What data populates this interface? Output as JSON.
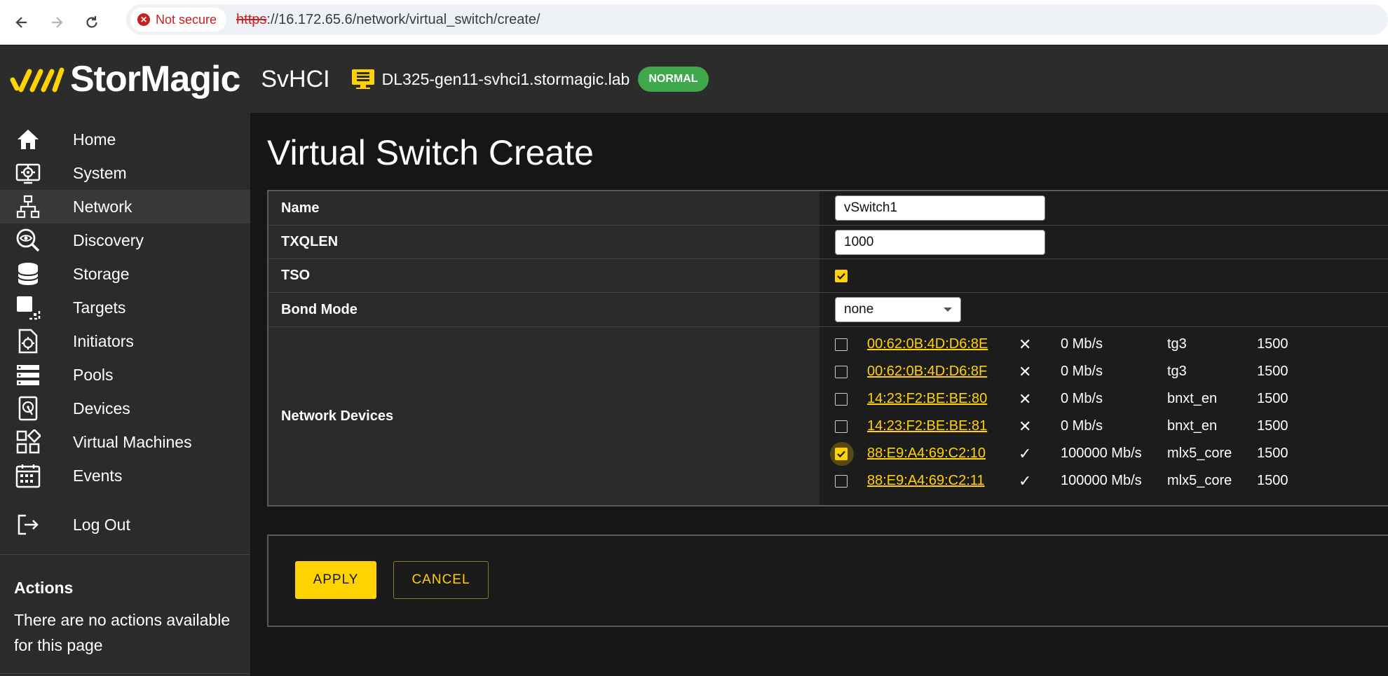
{
  "browser": {
    "security_label": "Not secure",
    "url_scheme": "https",
    "url_rest": "://16.172.65.6/network/virtual_switch/create/"
  },
  "header": {
    "brand": "StorMagic",
    "product": "SvHCI",
    "hostname": "DL325-gen11-svhci1.stormagic.lab",
    "status": "NORMAL",
    "logo_color": "#ffd200",
    "status_color": "#3fa84a"
  },
  "sidebar": {
    "items": [
      {
        "label": "Home",
        "icon": "home-icon"
      },
      {
        "label": "System",
        "icon": "system-icon"
      },
      {
        "label": "Network",
        "icon": "network-icon",
        "active": true
      },
      {
        "label": "Discovery",
        "icon": "discovery-icon"
      },
      {
        "label": "Storage",
        "icon": "storage-icon"
      },
      {
        "label": "Targets",
        "icon": "targets-icon"
      },
      {
        "label": "Initiators",
        "icon": "initiators-icon"
      },
      {
        "label": "Pools",
        "icon": "pools-icon"
      },
      {
        "label": "Devices",
        "icon": "devices-icon"
      },
      {
        "label": "Virtual Machines",
        "icon": "virtual-machines-icon"
      },
      {
        "label": "Events",
        "icon": "events-icon"
      }
    ],
    "logout": "Log Out",
    "actions_title": "Actions",
    "actions_text": "There are no actions available for this page"
  },
  "main": {
    "title": "Virtual Switch Create",
    "form": {
      "name_label": "Name",
      "name_value": "vSwitch1",
      "txqlen_label": "TXQLEN",
      "txqlen_value": "1000",
      "tso_label": "TSO",
      "tso_checked": true,
      "bond_label": "Bond Mode",
      "bond_value": "none",
      "devices_label": "Network Devices"
    },
    "devices": [
      {
        "mac": "00:62:0B:4D:D6:8E",
        "link": "✕",
        "speed": "0 Mb/s",
        "driver": "tg3",
        "mtu": "1500",
        "checked": false
      },
      {
        "mac": "00:62:0B:4D:D6:8F",
        "link": "✕",
        "speed": "0 Mb/s",
        "driver": "tg3",
        "mtu": "1500",
        "checked": false
      },
      {
        "mac": "14:23:F2:BE:BE:80",
        "link": "✕",
        "speed": "0 Mb/s",
        "driver": "bnxt_en",
        "mtu": "1500",
        "checked": false
      },
      {
        "mac": "14:23:F2:BE:BE:81",
        "link": "✕",
        "speed": "0 Mb/s",
        "driver": "bnxt_en",
        "mtu": "1500",
        "checked": false
      },
      {
        "mac": "88:E9:A4:69:C2:10",
        "link": "✓",
        "speed": "100000 Mb/s",
        "driver": "mlx5_core",
        "mtu": "1500",
        "checked": true
      },
      {
        "mac": "88:E9:A4:69:C2:11",
        "link": "✓",
        "speed": "100000 Mb/s",
        "driver": "mlx5_core",
        "mtu": "1500",
        "checked": false
      }
    ],
    "apply_label": "APPLY",
    "cancel_label": "CANCEL"
  }
}
